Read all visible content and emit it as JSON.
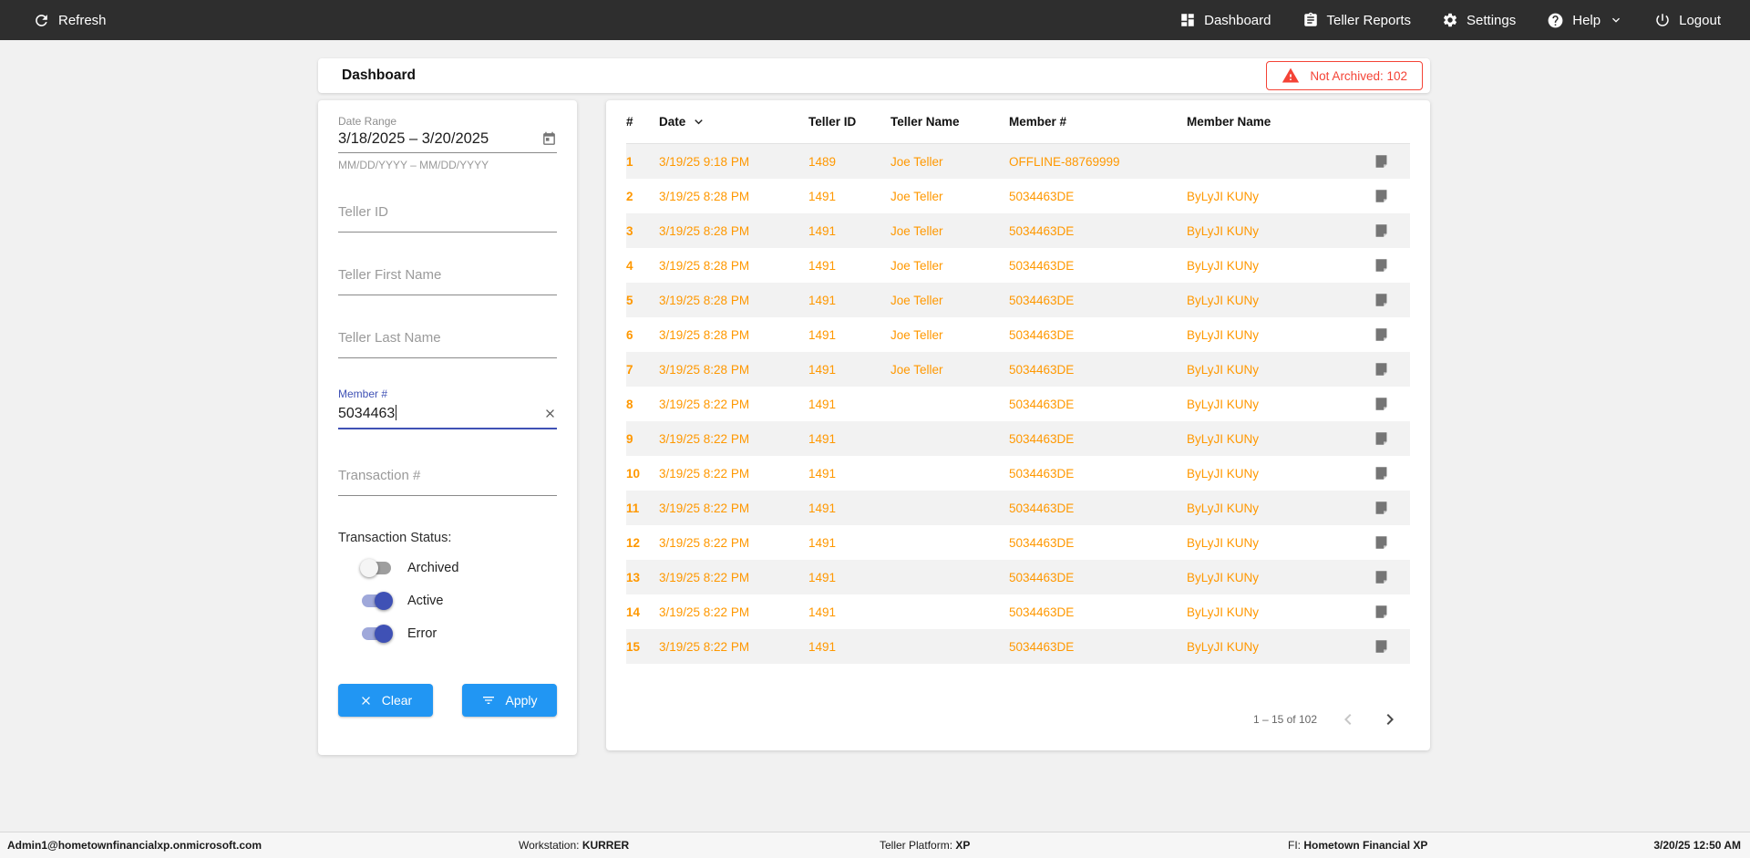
{
  "nav": {
    "refresh_label": "Refresh",
    "items": [
      {
        "label": "Dashboard"
      },
      {
        "label": "Teller Reports"
      },
      {
        "label": "Settings"
      },
      {
        "label": "Help"
      },
      {
        "label": "Logout"
      }
    ]
  },
  "header": {
    "title": "Dashboard",
    "alert": "Not Archived: 102"
  },
  "filters": {
    "date_range": {
      "label": "Date Range",
      "value": "3/18/2025 – 3/20/2025",
      "hint": "MM/DD/YYYY – MM/DD/YYYY"
    },
    "teller_id_placeholder": "Teller ID",
    "teller_first_name_placeholder": "Teller First Name",
    "teller_last_name_placeholder": "Teller Last Name",
    "member_number": {
      "label": "Member #",
      "value": "5034463"
    },
    "transaction_placeholder": "Transaction #",
    "status": {
      "label": "Transaction Status:",
      "toggles": [
        {
          "label": "Archived",
          "on": false
        },
        {
          "label": "Active",
          "on": true
        },
        {
          "label": "Error",
          "on": true
        }
      ]
    },
    "clear_label": "Clear",
    "apply_label": "Apply"
  },
  "table": {
    "columns": [
      "#",
      "Date",
      "Teller ID",
      "Teller Name",
      "Member #",
      "Member Name"
    ],
    "rows": [
      {
        "num": "1",
        "date": "3/19/25 9:18 PM",
        "teller_id": "1489",
        "teller_name": "Joe Teller",
        "member_number": "OFFLINE-88769999",
        "member_name": ""
      },
      {
        "num": "2",
        "date": "3/19/25 8:28 PM",
        "teller_id": "1491",
        "teller_name": "Joe Teller",
        "member_number": "5034463DE",
        "member_name": "ByLyJI KUNy"
      },
      {
        "num": "3",
        "date": "3/19/25 8:28 PM",
        "teller_id": "1491",
        "teller_name": "Joe Teller",
        "member_number": "5034463DE",
        "member_name": "ByLyJI KUNy"
      },
      {
        "num": "4",
        "date": "3/19/25 8:28 PM",
        "teller_id": "1491",
        "teller_name": "Joe Teller",
        "member_number": "5034463DE",
        "member_name": "ByLyJI KUNy"
      },
      {
        "num": "5",
        "date": "3/19/25 8:28 PM",
        "teller_id": "1491",
        "teller_name": "Joe Teller",
        "member_number": "5034463DE",
        "member_name": "ByLyJI KUNy"
      },
      {
        "num": "6",
        "date": "3/19/25 8:28 PM",
        "teller_id": "1491",
        "teller_name": "Joe Teller",
        "member_number": "5034463DE",
        "member_name": "ByLyJI KUNy"
      },
      {
        "num": "7",
        "date": "3/19/25 8:28 PM",
        "teller_id": "1491",
        "teller_name": "Joe Teller",
        "member_number": "5034463DE",
        "member_name": "ByLyJI KUNy"
      },
      {
        "num": "8",
        "date": "3/19/25 8:22 PM",
        "teller_id": "1491",
        "teller_name": "",
        "member_number": "5034463DE",
        "member_name": "ByLyJI KUNy"
      },
      {
        "num": "9",
        "date": "3/19/25 8:22 PM",
        "teller_id": "1491",
        "teller_name": "",
        "member_number": "5034463DE",
        "member_name": "ByLyJI KUNy"
      },
      {
        "num": "10",
        "date": "3/19/25 8:22 PM",
        "teller_id": "1491",
        "teller_name": "",
        "member_number": "5034463DE",
        "member_name": "ByLyJI KUNy"
      },
      {
        "num": "11",
        "date": "3/19/25 8:22 PM",
        "teller_id": "1491",
        "teller_name": "",
        "member_number": "5034463DE",
        "member_name": "ByLyJI KUNy"
      },
      {
        "num": "12",
        "date": "3/19/25 8:22 PM",
        "teller_id": "1491",
        "teller_name": "",
        "member_number": "5034463DE",
        "member_name": "ByLyJI KUNy"
      },
      {
        "num": "13",
        "date": "3/19/25 8:22 PM",
        "teller_id": "1491",
        "teller_name": "",
        "member_number": "5034463DE",
        "member_name": "ByLyJI KUNy"
      },
      {
        "num": "14",
        "date": "3/19/25 8:22 PM",
        "teller_id": "1491",
        "teller_name": "",
        "member_number": "5034463DE",
        "member_name": "ByLyJI KUNy"
      },
      {
        "num": "15",
        "date": "3/19/25 8:22 PM",
        "teller_id": "1491",
        "teller_name": "",
        "member_number": "5034463DE",
        "member_name": "ByLyJI KUNy"
      }
    ]
  },
  "pagination": {
    "range_label": "1 – 15 of 102"
  },
  "footer": {
    "user": "Admin1@hometownfinancialxp.onmicrosoft.com",
    "workstation_label": "Workstation:",
    "workstation_value": "KURRER",
    "platform_label": "Teller Platform:",
    "platform_value": "XP",
    "fi_label": "FI:",
    "fi_value": "Hometown Financial XP",
    "datetime": "3/20/25 12:50 AM"
  },
  "colors": {
    "topbar": "#2e2e2e",
    "accent_blue": "#2196f3",
    "toggle_indigo": "#3f51b5",
    "row_text_orange": "#ff9800",
    "alert_red": "#f44336"
  }
}
